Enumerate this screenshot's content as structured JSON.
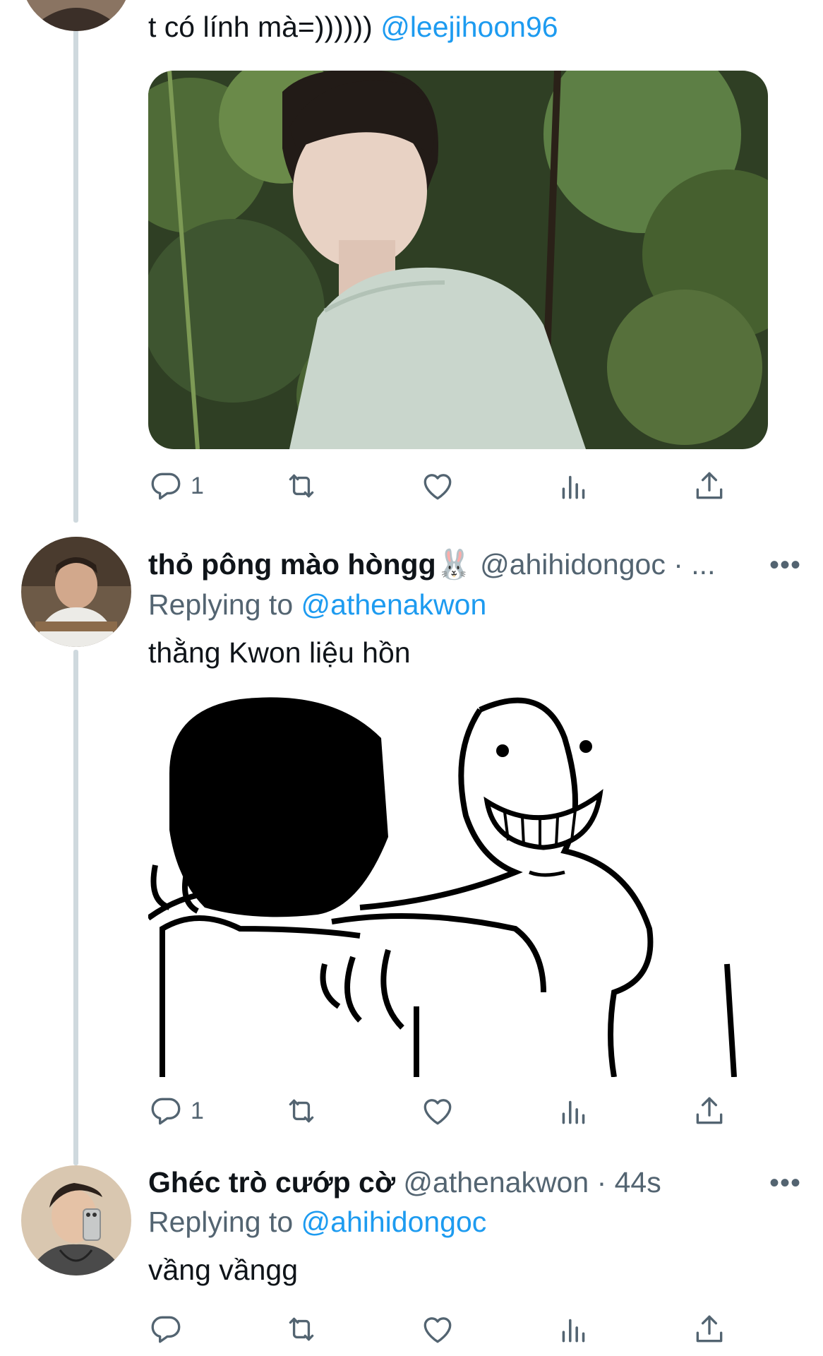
{
  "tweet1": {
    "text": "t có lính mà=))))))",
    "mention": "@leejihoon96",
    "reply_count": "1"
  },
  "tweet2": {
    "display_name": "thỏ pông mào hòngg🐰",
    "handle": "@ahihidongoc",
    "meta_sep": "· ...",
    "replying_label": "Replying to",
    "replying_to": "@athenakwon",
    "text": "thằng Kwon liệu hồn",
    "reply_count": "1"
  },
  "tweet3": {
    "display_name": "Ghéc trò cướp cờ",
    "handle": "@athenakwon",
    "time": "· 44s",
    "replying_label": "Replying to",
    "replying_to": "@ahihidongoc",
    "text": "vầng vầngg",
    "reply_count": ""
  },
  "more_glyph": "•••",
  "colors": {
    "accent": "#1d9bf0",
    "muted": "#536471",
    "thread_line": "#cfd9de"
  },
  "icons": [
    "reply-icon",
    "retweet-icon",
    "like-icon",
    "analytics-icon",
    "share-icon",
    "more-icon"
  ]
}
